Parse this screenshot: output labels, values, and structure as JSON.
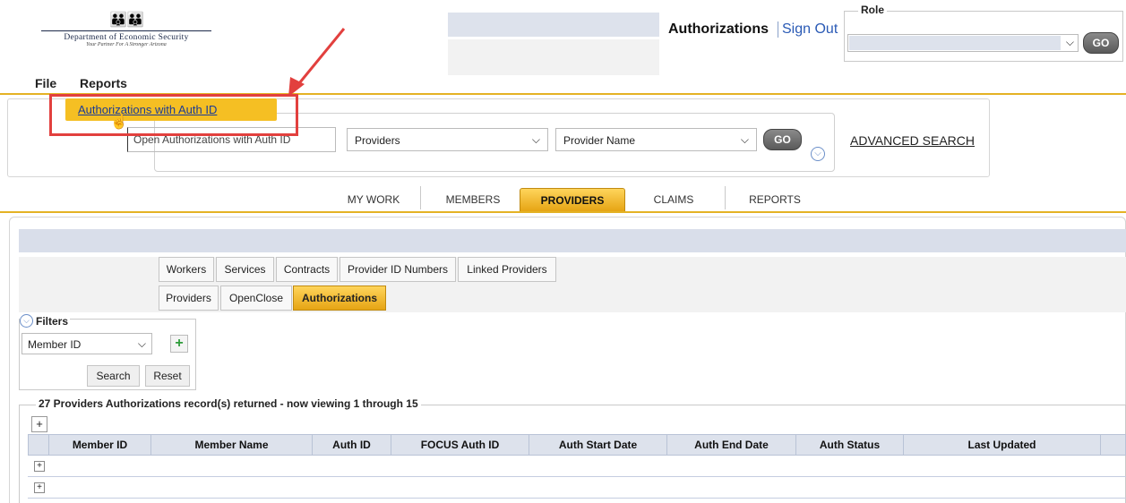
{
  "header": {
    "logo_title": "Department of Economic Security",
    "logo_tagline": "Your Partner For A Stronger Arizona",
    "page_title": "Authorizations",
    "sign_out_label": "Sign Out"
  },
  "role": {
    "legend": "Role",
    "go_label": "GO"
  },
  "menu": {
    "file": "File",
    "reports": "Reports",
    "dropdown_item": "Authorizations with Auth ID"
  },
  "search": {
    "type_value": "Open Authorizations with Auth ID",
    "category": "Providers",
    "field": "Provider Name",
    "go_label": "GO",
    "advanced_label": "ADVANCED SEARCH"
  },
  "main_tabs": [
    {
      "label": "MY WORK"
    },
    {
      "label": "MEMBERS"
    },
    {
      "label": "PROVIDERS"
    },
    {
      "label": "CLAIMS"
    },
    {
      "label": "REPORTS"
    }
  ],
  "sub_tabs_row1": [
    {
      "label": "Workers"
    },
    {
      "label": "Services"
    },
    {
      "label": "Contracts"
    },
    {
      "label": "Provider ID Numbers"
    },
    {
      "label": "Linked Providers"
    }
  ],
  "sub_tabs_row2": [
    {
      "label": "Providers"
    },
    {
      "label": "OpenClose"
    },
    {
      "label": "Authorizations"
    }
  ],
  "filters": {
    "legend": "Filters",
    "selected": "Member ID",
    "add_label": "+",
    "search_label": "Search",
    "reset_label": "Reset"
  },
  "results": {
    "summary": "27 Providers Authorizations record(s) returned - now viewing 1 through 15",
    "expand_all_label": "+",
    "row_expand_label": "+",
    "columns": [
      "Member ID",
      "Member Name",
      "Auth ID",
      "FOCUS Auth ID",
      "Auth Start Date",
      "Auth End Date",
      "Auth Status",
      "Last Updated"
    ]
  },
  "colors": {
    "accent_gold": "#f5bf23",
    "annotation_red": "#e2403e",
    "link_blue": "#2a5ab5"
  }
}
